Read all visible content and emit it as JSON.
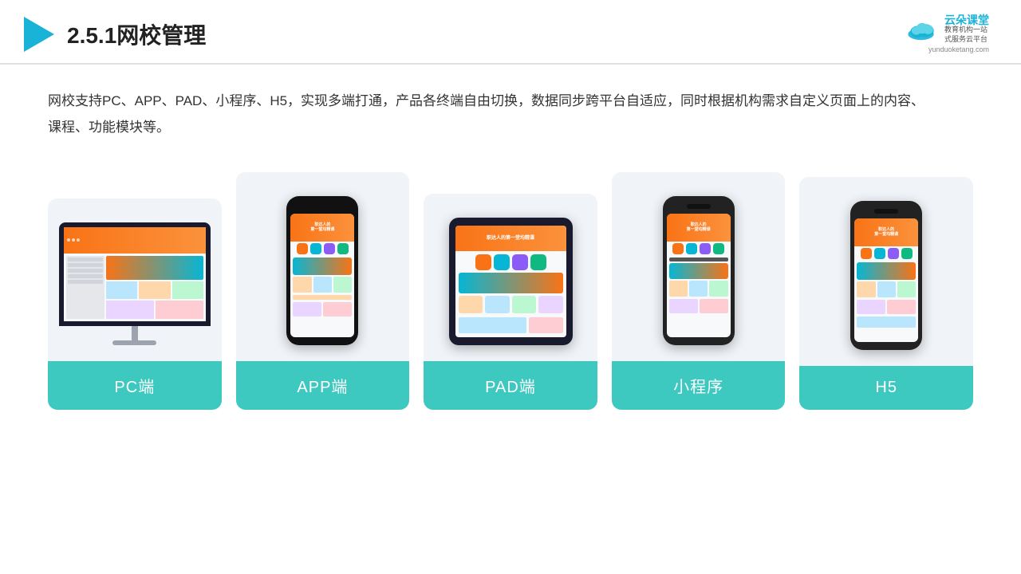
{
  "header": {
    "title": "2.5.1网校管理",
    "logo": {
      "brand": "云朵课堂",
      "slogan": "教育机构一站\n式服务云平台",
      "website": "yunduoketang.com"
    }
  },
  "description": "网校支持PC、APP、PAD、小程序、H5，实现多端打通，产品各终端自由切换，数据同步跨平台自适应，同时根据机构需求自定义页面上的内容、课程、功能模块等。",
  "cards": [
    {
      "id": "pc",
      "label": "PC端"
    },
    {
      "id": "app",
      "label": "APP端"
    },
    {
      "id": "pad",
      "label": "PAD端"
    },
    {
      "id": "miniapp",
      "label": "小程序"
    },
    {
      "id": "h5",
      "label": "H5"
    }
  ],
  "colors": {
    "teal": "#3dc8c0",
    "primary": "#1ab3d8",
    "orange": "#f97316"
  }
}
